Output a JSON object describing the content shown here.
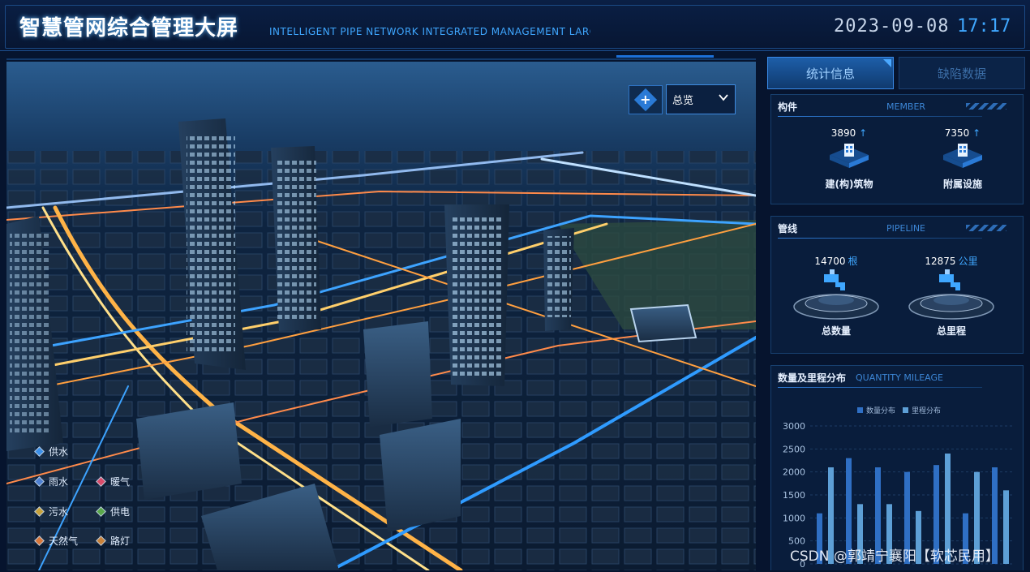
{
  "header": {
    "title": "智慧管网综合管理大屏",
    "subtitle": "INTELLIGENT PIPE NETWORK INTEGRATED MANAGEMENT LARGE S",
    "date": "2023-09-08",
    "time": "17:17"
  },
  "map": {
    "view_select": {
      "value": "总览"
    },
    "legend": [
      {
        "label": "供水",
        "color": "#3b8fe8"
      },
      {
        "label": "雨水",
        "color": "#4d7fd1"
      },
      {
        "label": "暖气",
        "color": "#d94b6a"
      },
      {
        "label": "污水",
        "color": "#c8a23a"
      },
      {
        "label": "供电",
        "color": "#5aa84a"
      },
      {
        "label": "天然气",
        "color": "#d8773a"
      },
      {
        "label": "路灯",
        "color": "#c9823a"
      }
    ]
  },
  "tabs": [
    {
      "label": "统计信息",
      "active": true
    },
    {
      "label": "缺陷数据",
      "active": false
    }
  ],
  "member": {
    "title": "构件",
    "title_en": "MEMBER",
    "items": [
      {
        "value": "3890",
        "arrow": "↑",
        "label": "建(构)筑物"
      },
      {
        "value": "7350",
        "arrow": "↑",
        "label": "附属设施"
      }
    ]
  },
  "pipeline": {
    "title": "管线",
    "title_en": "PIPELINE",
    "items": [
      {
        "value": "14700",
        "unit": "根",
        "label": "总数量"
      },
      {
        "value": "12875",
        "unit": "公里",
        "label": "总里程"
      }
    ]
  },
  "distribution": {
    "title": "数量及里程分布",
    "title_en": "QUANTITY MILEAGE"
  },
  "chart_data": {
    "type": "bar",
    "series": [
      {
        "name": "数量分布",
        "color": "#2f6fc4",
        "values": [
          1100,
          2300,
          2100,
          2000,
          2150,
          1100,
          2100
        ]
      },
      {
        "name": "里程分布",
        "color": "#5d9fd6",
        "values": [
          2100,
          1300,
          1300,
          1150,
          2400,
          2000,
          1600
        ]
      }
    ],
    "yticks": [
      "3000",
      "2500",
      "2000",
      "1500",
      "1000",
      "500",
      "0"
    ],
    "ylim": [
      0,
      3000
    ],
    "legend": "top-center",
    "grid": true
  },
  "watermark": "CSDN @郭靖宁襄阳【软芯民用】"
}
